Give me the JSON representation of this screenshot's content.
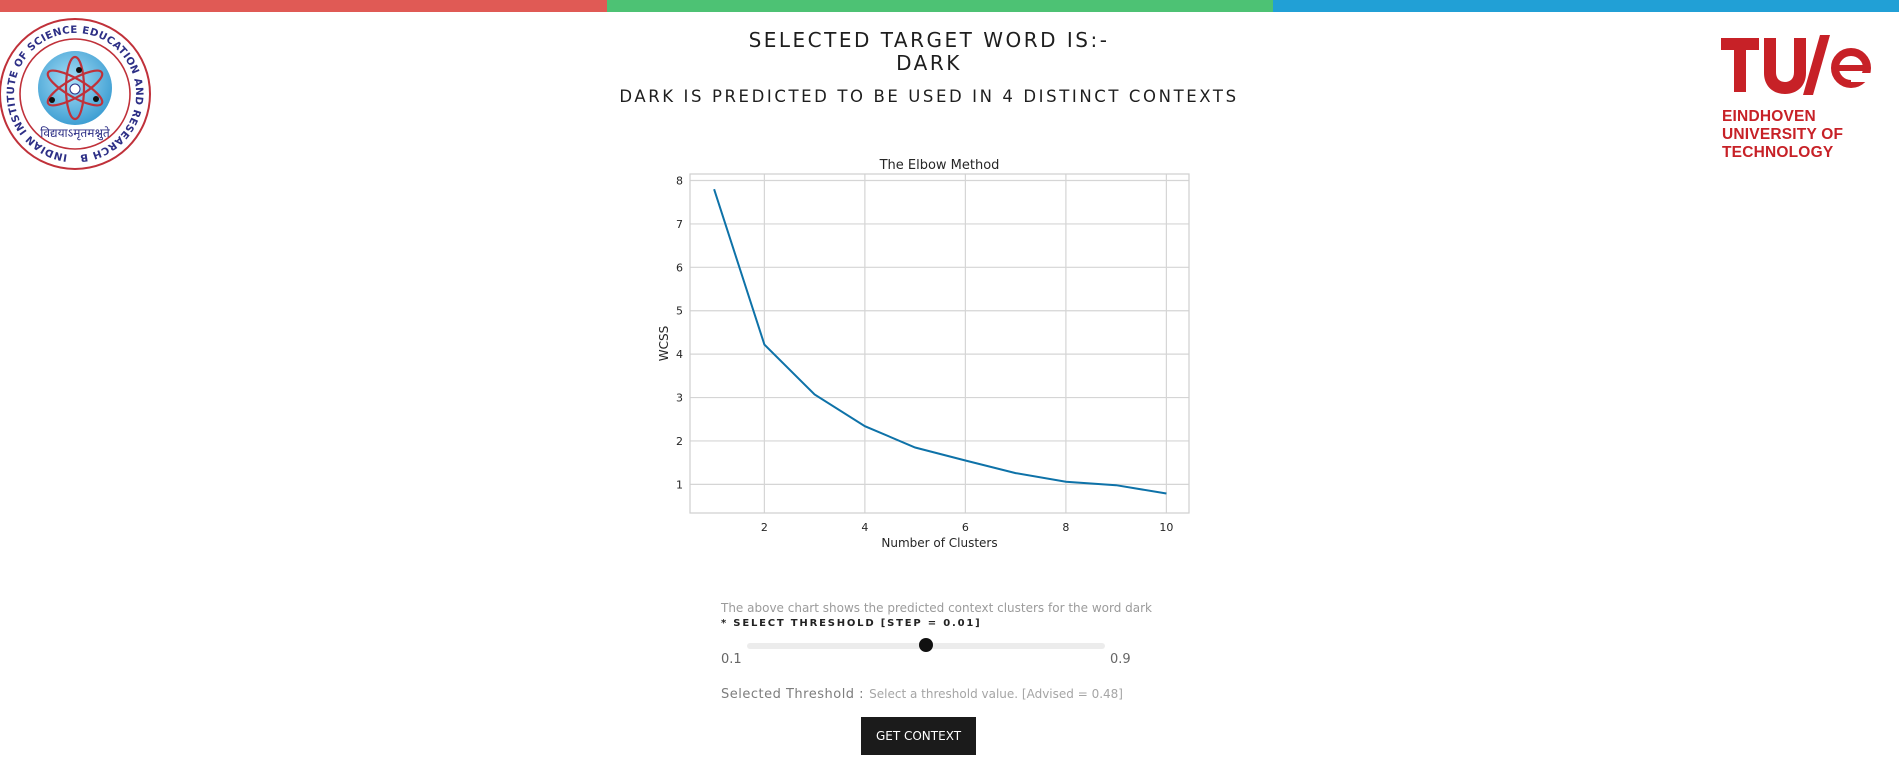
{
  "colors": {
    "bar_red": "#e05a55",
    "bar_green": "#4dc274",
    "bar_blue": "#21a0d6",
    "line": "#0e72a8",
    "tue_red": "#c72127",
    "iiser_blue": "#2d2f86",
    "iiser_red": "#c0313a"
  },
  "logos": {
    "left": {
      "icon": "iiser-bhopal-seal-icon",
      "ring_text": "INDIAN INSTITUTE OF SCIENCE EDUCATION AND RESEARCH BHOPAL",
      "motto": "विद्ययाऽमृतमश्नुते"
    },
    "right": {
      "icon": "tue-logo-icon",
      "mark": "TU/e",
      "name_lines": [
        "EINDHOVEN",
        "UNIVERSITY OF",
        "TECHNOLOGY"
      ]
    }
  },
  "header": {
    "title_line1": "SELECTED TARGET WORD IS:-",
    "title_line2": "DARK",
    "subtitle": "DARK IS PREDICTED TO BE USED IN 4 DISTINCT CONTEXTS"
  },
  "chart_data": {
    "type": "line",
    "title": "The Elbow Method",
    "xlabel": "Number of Clusters",
    "ylabel": "WCSS",
    "x": [
      1,
      2,
      3,
      4,
      5,
      6,
      7,
      8,
      9,
      10
    ],
    "series": [
      {
        "values": [
          7.8,
          4.22,
          3.07,
          2.34,
          1.85,
          1.55,
          1.26,
          1.06,
          0.98,
          0.79
        ]
      }
    ],
    "xticks": [
      2,
      4,
      6,
      8,
      10
    ],
    "yticks": [
      1,
      2,
      3,
      4,
      5,
      6,
      7,
      8
    ],
    "xlim": [
      0.52,
      10.45
    ],
    "ylim": [
      0.34,
      8.15
    ],
    "grid": true
  },
  "controls": {
    "caption": "The above chart shows the predicted context clusters for the word dark",
    "slider_label": "* SELECT THRESHOLD [STEP = 0.01]",
    "slider_min": "0.1",
    "slider_max": "0.9",
    "slider_value": 0.5,
    "threshold_label": "Selected Threshold :",
    "threshold_value": "Select a threshold value. [Advised = 0.48]",
    "button_label": "GET CONTEXT"
  }
}
